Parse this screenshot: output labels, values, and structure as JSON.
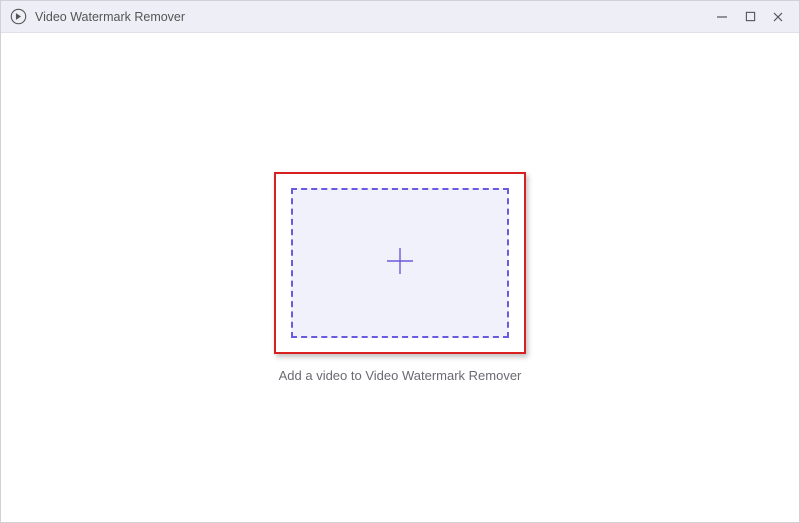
{
  "titlebar": {
    "title": "Video Watermark Remover"
  },
  "main": {
    "caption": "Add a video to Video Watermark Remover"
  },
  "icons": {
    "app": "app-logo-icon",
    "minimize": "minimize-icon",
    "maximize": "maximize-icon",
    "close": "close-icon",
    "plus": "plus-icon"
  },
  "colors": {
    "accent": "#6a5ae0",
    "highlight_border": "#d92020",
    "titlebar_bg": "#eeeef6",
    "dropzone_bg": "#f0f1fb"
  }
}
